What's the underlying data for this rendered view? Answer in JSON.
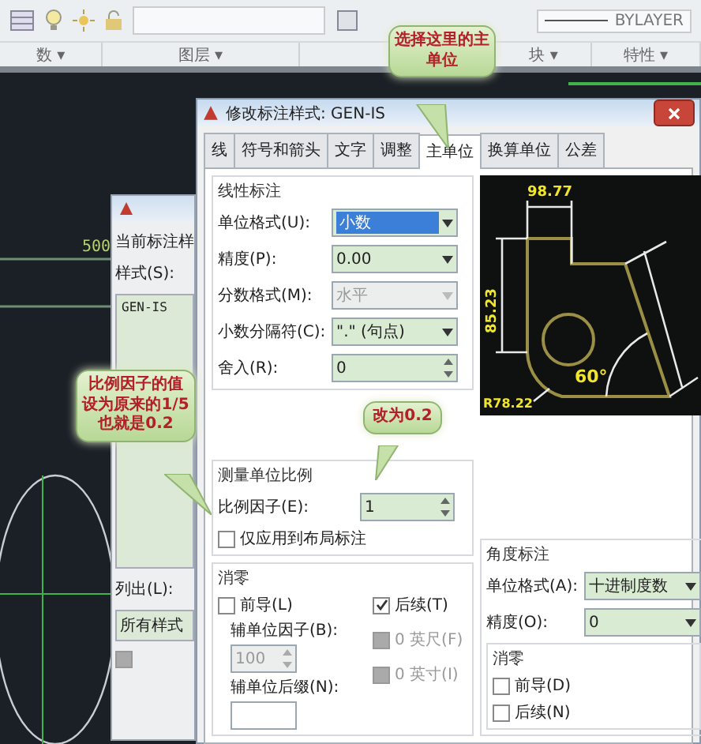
{
  "ribbon": {
    "groups": [
      {
        "label": "数",
        "caret": "▾"
      },
      {
        "label": "图层",
        "caret": "▾"
      },
      {
        "label": "块",
        "caret": "▾"
      },
      {
        "label": "特性",
        "caret": "▾"
      }
    ],
    "linetype": "BYLAYER"
  },
  "drawing": {
    "dimension": "500"
  },
  "manager_dialog": {
    "current_label": "当前标注样",
    "styles_label": "样式(S):",
    "style_item": "GEN-IS",
    "list_label": "列出(L):",
    "list_value": "所有样式",
    "option": {
      "checked": false,
      "disabled": true
    }
  },
  "dialog": {
    "title": "修改标注样式: GEN-IS",
    "tabs": [
      {
        "label": "线",
        "selected": false
      },
      {
        "label": "符号和箭头",
        "selected": false
      },
      {
        "label": "文字",
        "selected": false
      },
      {
        "label": "调整",
        "selected": false
      },
      {
        "label": "主单位",
        "selected": true
      },
      {
        "label": "换算单位",
        "selected": false
      },
      {
        "label": "公差",
        "selected": false
      }
    ],
    "linear": {
      "title": "线性标注",
      "fields": [
        {
          "label": "单位格式(U):",
          "value": "小数",
          "kind": "dropdown",
          "disabled": false,
          "selected": true
        },
        {
          "label": "精度(P):",
          "value": "0.00",
          "kind": "dropdown",
          "disabled": false,
          "selected": false
        },
        {
          "label": "分数格式(M):",
          "value": "水平",
          "kind": "dropdown",
          "disabled": true,
          "selected": false
        },
        {
          "label": "小数分隔符(C):",
          "value": "\".\" (句点)",
          "kind": "dropdown",
          "disabled": false,
          "selected": false
        },
        {
          "label": "舍入(R):",
          "value": "0",
          "kind": "spinner",
          "disabled": false,
          "selected": false
        }
      ]
    },
    "scale": {
      "title": "测量单位比例",
      "factor_label": "比例因子(E):",
      "factor_value": "1",
      "layout_only": {
        "label": "仅应用到布局标注",
        "checked": false
      }
    },
    "zero": {
      "title": "消零",
      "leading": {
        "label": "前导(L)",
        "checked": false,
        "disabled": false
      },
      "trailing": {
        "label": "后续(T)",
        "checked": true,
        "disabled": false
      },
      "sub_factor_label": "辅单位因子(B):",
      "sub_factor_value": "100",
      "sub_suffix_label": "辅单位后缀(N):",
      "feet": {
        "label": "0 英尺(F)",
        "checked": false,
        "disabled": true
      },
      "inches": {
        "label": "0 英寸(I)",
        "checked": false,
        "disabled": true
      }
    },
    "preview": {
      "width_dim": "98.77",
      "height_dim": "85.23",
      "angle": "60°",
      "radius": "R78.22"
    },
    "angular": {
      "title": "角度标注",
      "fields": [
        {
          "label": "单位格式(A):",
          "value": "十进制度数",
          "kind": "dropdown",
          "disabled": false,
          "selected": false
        },
        {
          "label": "精度(O):",
          "value": "0",
          "kind": "dropdown",
          "disabled": false,
          "selected": false
        }
      ],
      "zero_title": "消零",
      "options": [
        {
          "label": "前导(D)",
          "checked": false,
          "disabled": false
        },
        {
          "label": "后续(N)",
          "checked": false,
          "disabled": false
        }
      ]
    }
  },
  "callouts": [
    {
      "text": "选择这里的主单位"
    },
    {
      "text": "比例因子的值设为原来的1/5也就是0.2"
    },
    {
      "text": "改为0.2"
    }
  ]
}
